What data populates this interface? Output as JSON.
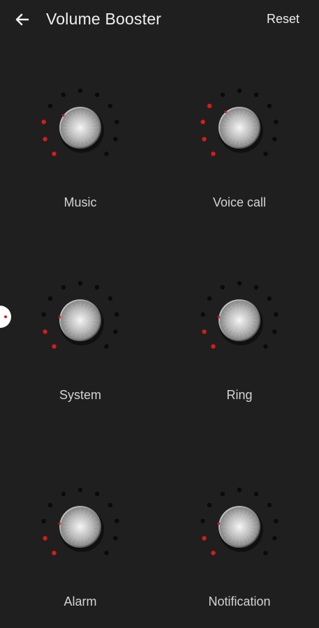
{
  "header": {
    "title": "Volume Booster",
    "reset_label": "Reset",
    "back_icon": "arrow-left-icon"
  },
  "colors": {
    "background": "#1f1f1f",
    "active_dot": "#d41c1c",
    "inactive_dot": "#0a0a0a"
  },
  "knobs": [
    {
      "id": "music",
      "label": "Music",
      "level": 0.3
    },
    {
      "id": "voice-call",
      "label": "Voice call",
      "level": 0.35
    },
    {
      "id": "system",
      "label": "System",
      "level": 0.2
    },
    {
      "id": "ring",
      "label": "Ring",
      "level": 0.2
    },
    {
      "id": "alarm",
      "label": "Alarm",
      "level": 0.2
    },
    {
      "id": "notification",
      "label": "Notification",
      "level": 0.2
    }
  ]
}
